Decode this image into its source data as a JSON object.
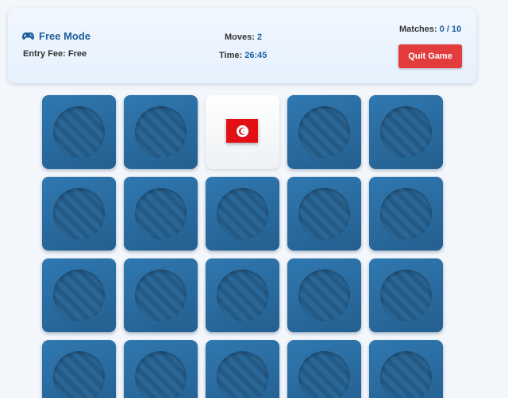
{
  "header": {
    "mode_icon": "gamepad-icon",
    "mode_label": "Free Mode",
    "entry_fee_label": "Entry Fee:",
    "entry_fee_value": "Free",
    "moves_label": "Moves:",
    "moves_value": "2",
    "time_label": "Time:",
    "time_value": "26:45",
    "matches_label": "Matches:",
    "matches_value": "0 / 10",
    "quit_label": "Quit Game"
  },
  "colors": {
    "accent": "#1f5f9b",
    "card_back": "#2f78b1",
    "quit": "#e23c3c",
    "flag_red": "#e20f15"
  },
  "board": {
    "columns": 5,
    "visible_rows": 4,
    "cards": [
      {
        "state": "down"
      },
      {
        "state": "down"
      },
      {
        "state": "up",
        "face": "tunisia-flag-icon"
      },
      {
        "state": "down"
      },
      {
        "state": "down"
      },
      {
        "state": "down"
      },
      {
        "state": "down"
      },
      {
        "state": "down"
      },
      {
        "state": "down"
      },
      {
        "state": "down"
      },
      {
        "state": "down"
      },
      {
        "state": "down"
      },
      {
        "state": "down"
      },
      {
        "state": "down"
      },
      {
        "state": "down"
      },
      {
        "state": "down"
      },
      {
        "state": "down"
      },
      {
        "state": "down"
      },
      {
        "state": "down"
      },
      {
        "state": "down"
      }
    ]
  }
}
